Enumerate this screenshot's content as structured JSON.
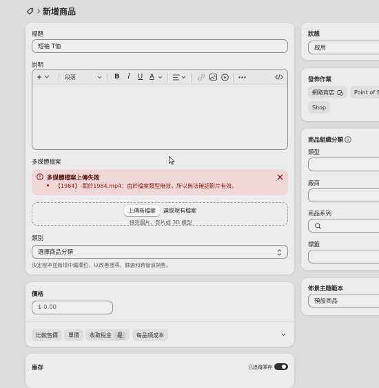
{
  "header": {
    "title": "新增商品"
  },
  "title_field": {
    "label": "標題",
    "value": "短袖 T恤"
  },
  "description": {
    "label": "說明",
    "toolbar": {
      "paragraph": "段落",
      "bold": "B",
      "italic": "I",
      "underline": "U",
      "text_color": "A"
    }
  },
  "media": {
    "label": "多媒體檔案",
    "error_title": "多媒體檔案上傳失敗",
    "error_item": "【1984】-關於1984.mp4：由於檔案類型無效，所以無法確認影片有效。",
    "upload_button": "上傳新檔案",
    "select_existing": "選取現有檔案",
    "hint": "接受圖片、影片或 3D 模型"
  },
  "category": {
    "label": "類別",
    "placeholder": "選擇商品分類",
    "help": "決定稅率並新增中繼欄位，以改善搜尋、篩選和跨管道銷售。"
  },
  "price": {
    "label": "價格",
    "value": "$  0.00",
    "chips": [
      "比較售價",
      "單價",
      "收取稅金",
      "每品項成本"
    ],
    "tax_value": "是"
  },
  "inventory": {
    "label": "庫存",
    "tracked_label": "已追蹤庫存"
  },
  "status": {
    "label": "狀態",
    "value": "啟用"
  },
  "publishing": {
    "label": "發佈作業",
    "channels": [
      "網路商店",
      "Point of S",
      "Shop"
    ]
  },
  "organization": {
    "label": "商品組織分類",
    "type_label": "類型",
    "vendor_label": "廠商",
    "collections_label": "商品系列",
    "tags_label": "標籤"
  },
  "theme_template": {
    "label": "佈景主題範本",
    "value": "預設商品"
  }
}
